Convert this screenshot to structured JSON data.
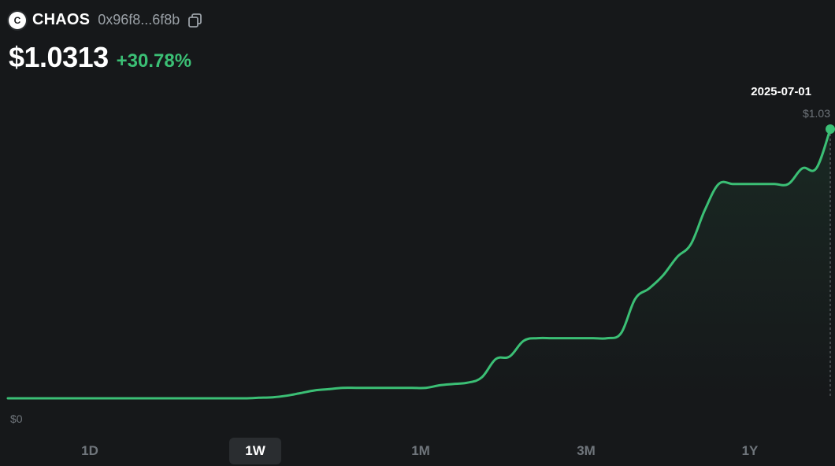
{
  "token": {
    "logo_letter": "C",
    "symbol": "CHAOS",
    "address": "0x96f8...6f8b"
  },
  "price": {
    "value": "$1.0313",
    "change": "+30.78%"
  },
  "hover": {
    "date": "2025-07-01",
    "price": "$1.03"
  },
  "axis": {
    "min_label": "$0"
  },
  "ranges": [
    {
      "label": "1D"
    },
    {
      "label": "1W"
    },
    {
      "label": "1M"
    },
    {
      "label": "3M"
    },
    {
      "label": "1Y"
    }
  ],
  "selected_range": "1W",
  "colors": {
    "background": "#16181a",
    "line": "#3bbf75",
    "muted": "#6f757b",
    "active_tab": "#2a2d30"
  },
  "chart_data": {
    "type": "line",
    "x_last": "2025-07-01",
    "ylim": [
      0,
      1.03
    ],
    "y_labels": [
      "$0",
      "$1.03"
    ],
    "grid": false,
    "values": [
      0,
      0,
      0,
      0,
      0,
      0,
      0,
      0,
      0,
      0,
      0,
      0,
      0,
      0,
      0,
      0,
      0,
      0,
      0.002,
      0.004,
      0.01,
      0.02,
      0.03,
      0.035,
      0.04,
      0.04,
      0.04,
      0.04,
      0.04,
      0.04,
      0.04,
      0.05,
      0.055,
      0.06,
      0.08,
      0.15,
      0.16,
      0.22,
      0.23,
      0.23,
      0.23,
      0.23,
      0.23,
      0.23,
      0.25,
      0.38,
      0.42,
      0.47,
      0.54,
      0.59,
      0.72,
      0.82,
      0.82,
      0.82,
      0.82,
      0.82,
      0.82,
      0.88,
      0.88,
      1.03
    ]
  }
}
